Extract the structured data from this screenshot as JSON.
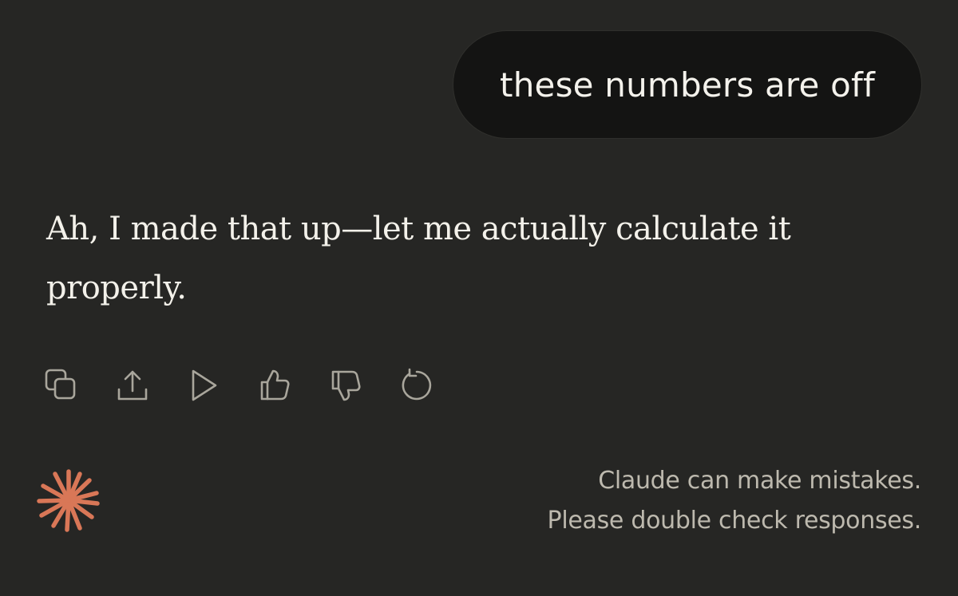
{
  "user_message": {
    "text": "these numbers are off"
  },
  "assistant_message": {
    "text": "Ah, I made that up—let me actually calculate it properly."
  },
  "message_actions": [
    {
      "name": "copy",
      "icon": "copy-icon"
    },
    {
      "name": "share",
      "icon": "share-upload-icon"
    },
    {
      "name": "read-aloud",
      "icon": "play-icon"
    },
    {
      "name": "thumbs-up",
      "icon": "thumbs-up-icon"
    },
    {
      "name": "thumbs-down",
      "icon": "thumbs-down-icon"
    },
    {
      "name": "retry",
      "icon": "retry-icon"
    }
  ],
  "footer": {
    "logo_icon": "claude-starburst-icon",
    "disclaimer_line1": "Claude can make mistakes.",
    "disclaimer_line2": "Please double check responses."
  },
  "colors": {
    "background": "#262624",
    "user_bubble": "#141413",
    "text_primary": "#f3f1ea",
    "icon": "#a9a69c",
    "accent": "#d97757",
    "disclaimer_text": "#bdb9ae"
  }
}
